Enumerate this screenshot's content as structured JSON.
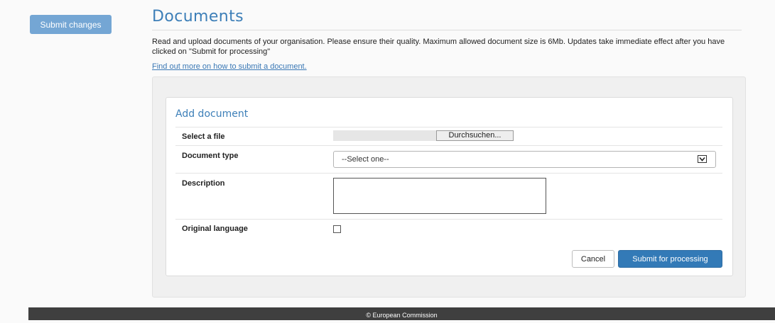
{
  "sidebar": {
    "submit_changes_label": "Submit changes"
  },
  "header": {
    "title": "Documents",
    "intro": "Read and upload documents of your organisation. Please ensure their quality. Maximum allowed document size is 6Mb. Updates take immediate effect after you have clicked on \"Submit for processing\"",
    "help_link": "Find out more on how to submit a document."
  },
  "form": {
    "title": "Add document",
    "file": {
      "label": "Select a file",
      "button_label": "Durchsuchen..."
    },
    "doc_type": {
      "label": "Document type",
      "selected": "--Select one--"
    },
    "description": {
      "label": "Description",
      "value": ""
    },
    "original_language": {
      "label": "Original language",
      "checked": false
    },
    "cancel_label": "Cancel",
    "submit_label": "Submit for processing"
  },
  "footer": {
    "text": "© European Commission"
  },
  "colors": {
    "accent": "#3d7fb8",
    "primary_button": "#337ab7",
    "submit_changes_button": "#74a6d4",
    "footer": "#3f3f3f"
  }
}
